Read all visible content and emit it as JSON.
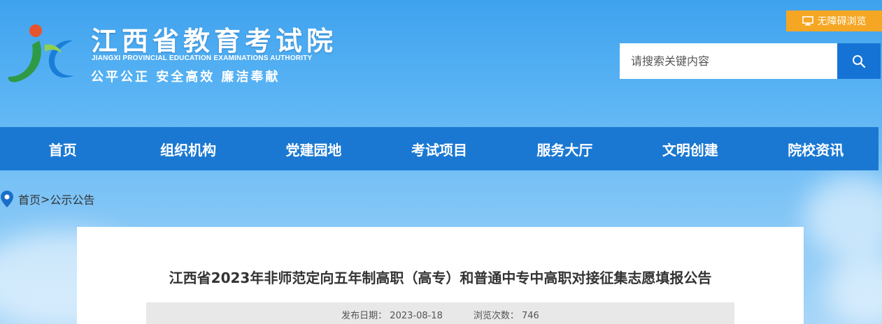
{
  "header": {
    "site_title": "江西省教育考试院",
    "site_subtitle": "JIANGXI PROVINCIAL EDUCATION EXAMINATIONS AUTHORITY",
    "slogan": "公平公正  安全高效  廉洁奉献",
    "accessibility_label": "无障碍浏览",
    "search_placeholder": "请搜索关键内容"
  },
  "nav": {
    "items": [
      "首页",
      "组织机构",
      "党建园地",
      "考试项目",
      "服务大厅",
      "文明创建",
      "院校资讯"
    ]
  },
  "breadcrumb": {
    "home": "首页",
    "separator": ">",
    "current": "公示公告"
  },
  "article": {
    "title": "江西省2023年非师范定向五年制高职（高专）和普通中专中高职对接征集志愿填报公告",
    "publish_label": "发布日期：",
    "publish_date": "2023-08-18",
    "views_label": "浏览次数：",
    "views": "746"
  },
  "colors": {
    "nav_bg": "#1a78d2",
    "search_button": "#1673d6",
    "accessibility_button": "#f5a623"
  }
}
